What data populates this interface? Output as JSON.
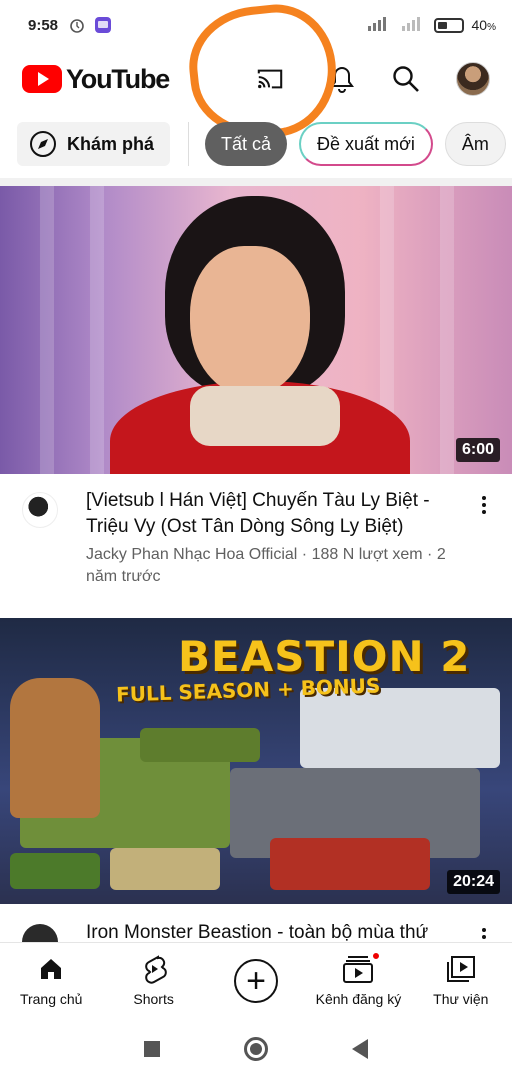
{
  "status_bar": {
    "time": "9:58",
    "battery": "40",
    "battery_unit": "%",
    "battery_level": 0.4
  },
  "header": {
    "logo_text": "YouTube",
    "icons": [
      "cast-icon",
      "bell-icon",
      "search-icon",
      "avatar"
    ]
  },
  "chips": {
    "explore": "Khám phá",
    "items": [
      "Tất cả",
      "Đề xuất mới",
      "Âm"
    ]
  },
  "videos": [
    {
      "title": "[Vietsub l Hán Việt] Chuyến Tàu Ly Biệt - Triệu Vy (Ost Tân Dòng Sông Ly Biệt)",
      "meta": "Jacky Phan Nhạc Hoa Official · 188 N lượt xem · 2 năm trước",
      "duration": "6:00"
    },
    {
      "title": "Iron Monster Beastion - toàn bộ mùa thứ",
      "thumb_title": "BEASTION 2",
      "thumb_subtitle": "FULL SEASON + BONUS",
      "duration": "20:24"
    }
  ],
  "bottom_nav": [
    {
      "label": "Trang chủ",
      "icon": "home-icon"
    },
    {
      "label": "Shorts",
      "icon": "shorts-icon"
    },
    {
      "label": "",
      "icon": "create-plus-icon"
    },
    {
      "label": "Kênh đăng ký",
      "icon": "subscriptions-icon"
    },
    {
      "label": "Thư viện",
      "icon": "library-icon"
    }
  ],
  "colors": {
    "brand_red": "#ff0000",
    "annotation_orange": "#f5821f",
    "active_chip": "#606060"
  }
}
